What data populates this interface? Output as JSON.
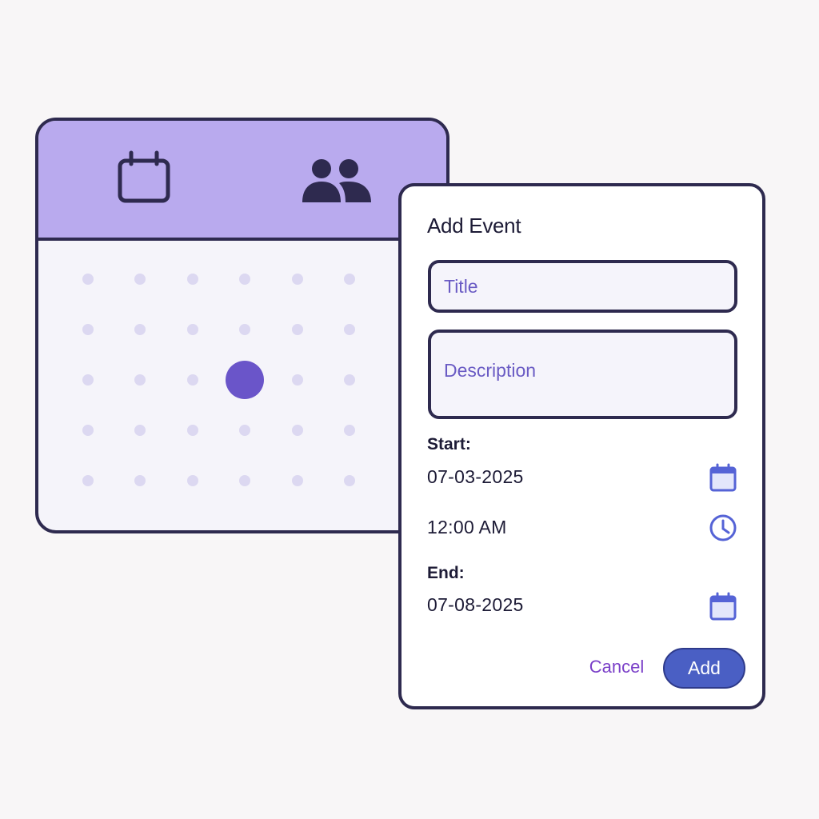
{
  "calendar": {
    "header_icons": [
      "calendar-icon",
      "people-icon"
    ],
    "grid": {
      "rows": 5,
      "columns": 6,
      "selected": {
        "row": 3,
        "column": 4
      }
    }
  },
  "dialog": {
    "title": "Add Event",
    "title_placeholder": "Title",
    "description_placeholder": "Description",
    "start_label": "Start:",
    "start_date": "07-03-2025",
    "start_time": "12:00 AM",
    "end_label": "End:",
    "end_date": "07-08-2025",
    "cancel_label": "Cancel",
    "add_label": "Add"
  },
  "colors": {
    "page_background": "#f8f6f7",
    "header_purple": "#b9aaee",
    "outline": "#2e2a4f",
    "dot": "#dcd8f1",
    "selected_dot": "#6a55c9",
    "add_button": "#4a5fc4",
    "cancel_text": "#7a3fc8",
    "icon_blue": "#5563d6"
  }
}
